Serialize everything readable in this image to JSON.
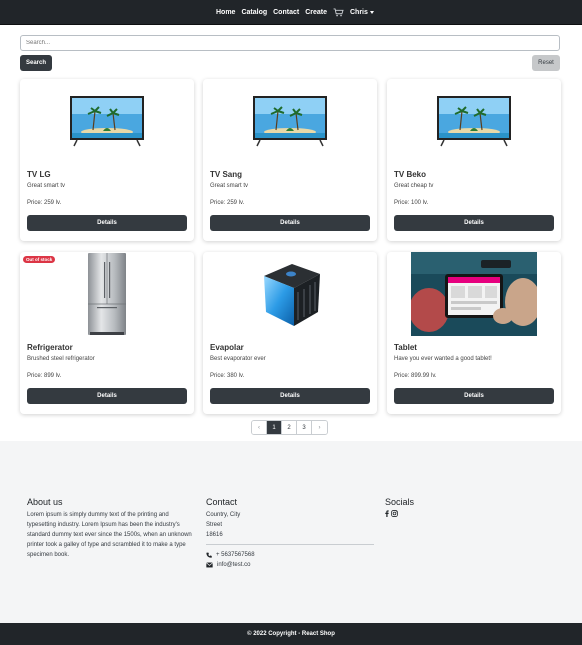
{
  "nav": {
    "links": [
      "Home",
      "Catalog",
      "Contact",
      "Create"
    ],
    "cart_icon": "cart-icon",
    "user": "Chris"
  },
  "search": {
    "placeholder": "Search...",
    "search_label": "Search",
    "reset_label": "Reset"
  },
  "products": [
    {
      "title": "TV LG",
      "desc": "Great smart tv",
      "price": "Price: 259 lv.",
      "button": "Details",
      "image": "tv-image",
      "badge": ""
    },
    {
      "title": "TV Sang",
      "desc": "Great smart tv",
      "price": "Price: 259 lv.",
      "button": "Details",
      "image": "tv-image",
      "badge": ""
    },
    {
      "title": "TV Beko",
      "desc": "Great cheap tv",
      "price": "Price: 100 lv.",
      "button": "Details",
      "image": "tv-image",
      "badge": ""
    },
    {
      "title": "Refrigerator",
      "desc": "Brushed steel refrigerator",
      "price": "Price: 899 lv.",
      "button": "Details",
      "image": "refrigerator-image",
      "badge": "Out of stock"
    },
    {
      "title": "Evapolar",
      "desc": "Best evaporator ever",
      "price": "Price: 380 lv.",
      "button": "Details",
      "image": "evaporator-image",
      "badge": ""
    },
    {
      "title": "Tablet",
      "desc": "Have you ever wanted a good tablet!",
      "price": "Price: 899.99 lv.",
      "button": "Details",
      "image": "tablet-image",
      "badge": ""
    }
  ],
  "pagination": {
    "prev": "‹",
    "pages": [
      "1",
      "2",
      "3"
    ],
    "active": "1",
    "next": "›"
  },
  "footer": {
    "about": {
      "heading": "About us",
      "text": "Lorem ipsum is simply dummy text of the printing and typesetting industry. Lorem Ipsum has been the industry's standard dummy text ever since the 1500s, when an unknown printer took a galley of type and scrambled it to make a type specimen book."
    },
    "contact": {
      "heading": "Contact",
      "country": "Country, City",
      "street": "Street",
      "zip": "18616",
      "phone": "+ 5637567568",
      "email": "info@test.co"
    },
    "socials": {
      "heading": "Socials",
      "icons": [
        "facebook-icon",
        "instagram-icon"
      ]
    },
    "copyright": "© 2022 Copyright - React Shop"
  },
  "colors": {
    "navbar": "#212529",
    "button_dark": "#343a40",
    "badge": "#dc3545",
    "footer_bg": "#f4f5f6"
  }
}
